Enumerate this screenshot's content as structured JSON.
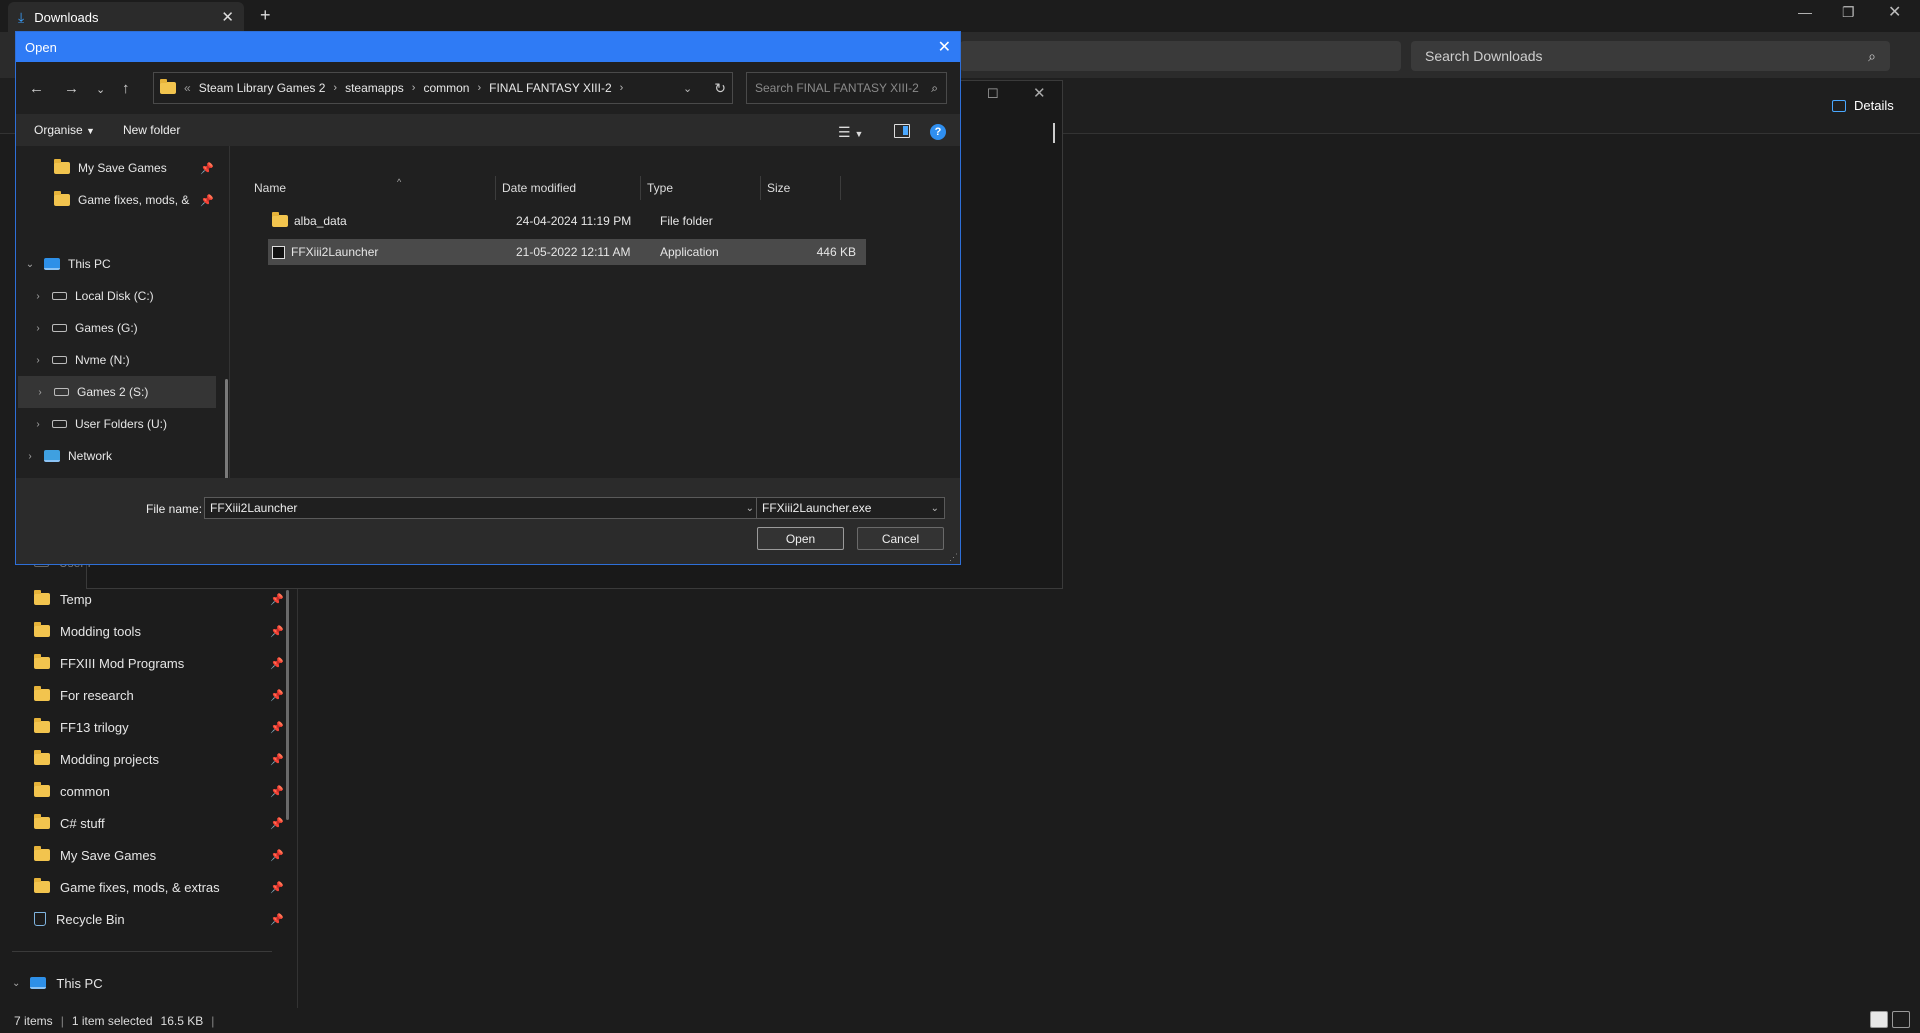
{
  "explorer": {
    "tab_label": "Downloads",
    "tab_icon": "download-icon",
    "new_tab": "+",
    "search_placeholder": "Search Downloads",
    "details_label": "Details",
    "sidebar_items": [
      {
        "label": "Temp",
        "icon": "folder-icon"
      },
      {
        "label": "Modding tools",
        "icon": "folder-icon"
      },
      {
        "label": "FFXIII Mod Programs",
        "icon": "folder-icon"
      },
      {
        "label": "For research",
        "icon": "folder-icon"
      },
      {
        "label": "FF13 trilogy",
        "icon": "folder-icon"
      },
      {
        "label": "Modding projects",
        "icon": "folder-icon"
      },
      {
        "label": "common",
        "icon": "folder-icon"
      },
      {
        "label": "C# stuff",
        "icon": "folder-icon"
      },
      {
        "label": "My Save Games",
        "icon": "folder-icon"
      },
      {
        "label": "Game fixes, mods, & extras",
        "icon": "folder-icon"
      },
      {
        "label": "Recycle Bin",
        "icon": "recycle-bin-icon"
      }
    ],
    "this_pc": "This PC",
    "ghost_user": "User F",
    "status": {
      "items": "7 items",
      "selected": "1 item selected",
      "size": "16.5 KB"
    }
  },
  "dialog": {
    "title": "Open",
    "breadcrumb": [
      "Steam Library Games 2",
      "steamapps",
      "common",
      "FINAL FANTASY XIII-2"
    ],
    "breadcrumb_overflow": "«",
    "search_placeholder": "Search FINAL FANTASY XIII-2",
    "toolbar": {
      "organise": "Organise",
      "new_folder": "New folder"
    },
    "nav_items": [
      {
        "label": "My Save Games",
        "icon": "folder-icon",
        "pinned": true
      },
      {
        "label": "Game fixes, mods, & ext",
        "icon": "folder-icon",
        "pinned": true
      },
      {
        "label": "This PC",
        "icon": "pc-icon",
        "expanded": true
      },
      {
        "label": "Local Disk (C:)",
        "icon": "drive-icon"
      },
      {
        "label": "Games (G:)",
        "icon": "drive-icon"
      },
      {
        "label": "Nvme (N:)",
        "icon": "drive-icon"
      },
      {
        "label": "Games 2 (S:)",
        "icon": "drive-icon",
        "selected": true
      },
      {
        "label": "User Folders (U:)",
        "icon": "drive-icon"
      },
      {
        "label": "Network",
        "icon": "network-icon"
      }
    ],
    "columns": [
      "Name",
      "Date modified",
      "Type",
      "Size"
    ],
    "files": [
      {
        "name": "alba_data",
        "date": "24-04-2024 11:19 PM",
        "type": "File folder",
        "size": "",
        "icon": "folder-icon"
      },
      {
        "name": "FFXiii2Launcher",
        "date": "21-05-2022 12:11 AM",
        "type": "Application",
        "size": "446 KB",
        "icon": "application-icon",
        "selected": true
      }
    ],
    "file_name_label": "File name:",
    "file_name_value": "FFXiii2Launcher",
    "file_type_value": "FFXiii2Launcher.exe",
    "open_button": "Open",
    "cancel_button": "Cancel"
  },
  "colors": {
    "accent": "#2f7bf5",
    "folder": "#f2c44e",
    "background": "#1c1c1c"
  }
}
